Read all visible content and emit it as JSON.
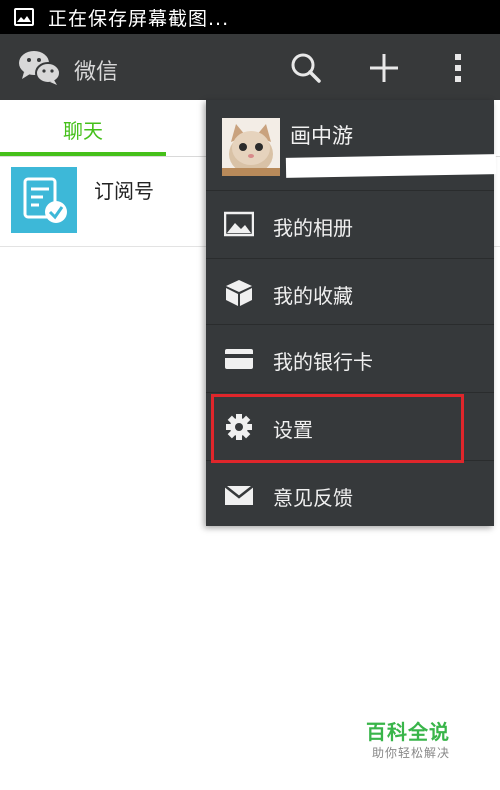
{
  "status_bar": {
    "text": "正在保存屏幕截图..."
  },
  "action_bar": {
    "title": "微信",
    "icons": [
      "wechat-logo",
      "search-icon",
      "add-icon",
      "more-icon"
    ]
  },
  "tabs": {
    "active": "聊天"
  },
  "chat_list": {
    "items": [
      {
        "title": "订阅号",
        "icon": "subscription-icon"
      }
    ]
  },
  "menu": {
    "profile_name": "画中游",
    "items": [
      {
        "label": "我的相册",
        "icon": "album-icon"
      },
      {
        "label": "我的收藏",
        "icon": "favorites-icon"
      },
      {
        "label": "我的银行卡",
        "icon": "bank-card-icon"
      },
      {
        "label": "设置",
        "icon": "settings-icon",
        "highlighted": true
      },
      {
        "label": "意见反馈",
        "icon": "feedback-icon"
      }
    ]
  },
  "watermark": {
    "title": "百科全说",
    "subtitle": "助你轻松解决"
  },
  "colors": {
    "accent_green": "#45c01a",
    "menu_bg": "#36393b",
    "highlight_red": "#e0262b",
    "action_bar": "#37393a"
  }
}
